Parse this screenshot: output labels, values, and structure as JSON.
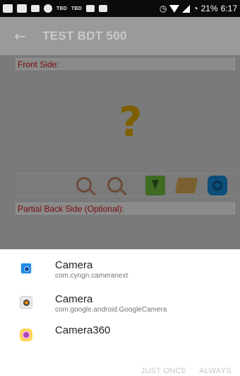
{
  "status_bar": {
    "battery_percent": "21%",
    "time": "6:17",
    "tbd_labels": [
      "TBD",
      "TBD"
    ]
  },
  "app_bar": {
    "back_icon": "←",
    "title": "TEST BDT 500"
  },
  "content": {
    "front_side_label": "Front Side:",
    "placeholder_glyph": "?",
    "partial_back_label": "Partial Back Side (Optional):",
    "tools": [
      "zoom-in-icon",
      "zoom-out-icon",
      "download-icon",
      "folder-icon",
      "camera-icon"
    ]
  },
  "chooser": {
    "items": [
      {
        "name": "Camera",
        "package": "com.cyngn.cameranext",
        "icon": "camera-icon"
      },
      {
        "name": "Camera",
        "package": "com.google.android.GoogleCamera",
        "icon": "google-camera-icon"
      },
      {
        "name": "Camera360",
        "package": "",
        "icon": "camera360-icon"
      }
    ],
    "just_once_label": "JUST ONCE",
    "always_label": "ALWAYS"
  },
  "colors": {
    "scrim": "#7a7a7a",
    "section_label": "#7a0b0b",
    "action_disabled": "#c8c8c8"
  }
}
